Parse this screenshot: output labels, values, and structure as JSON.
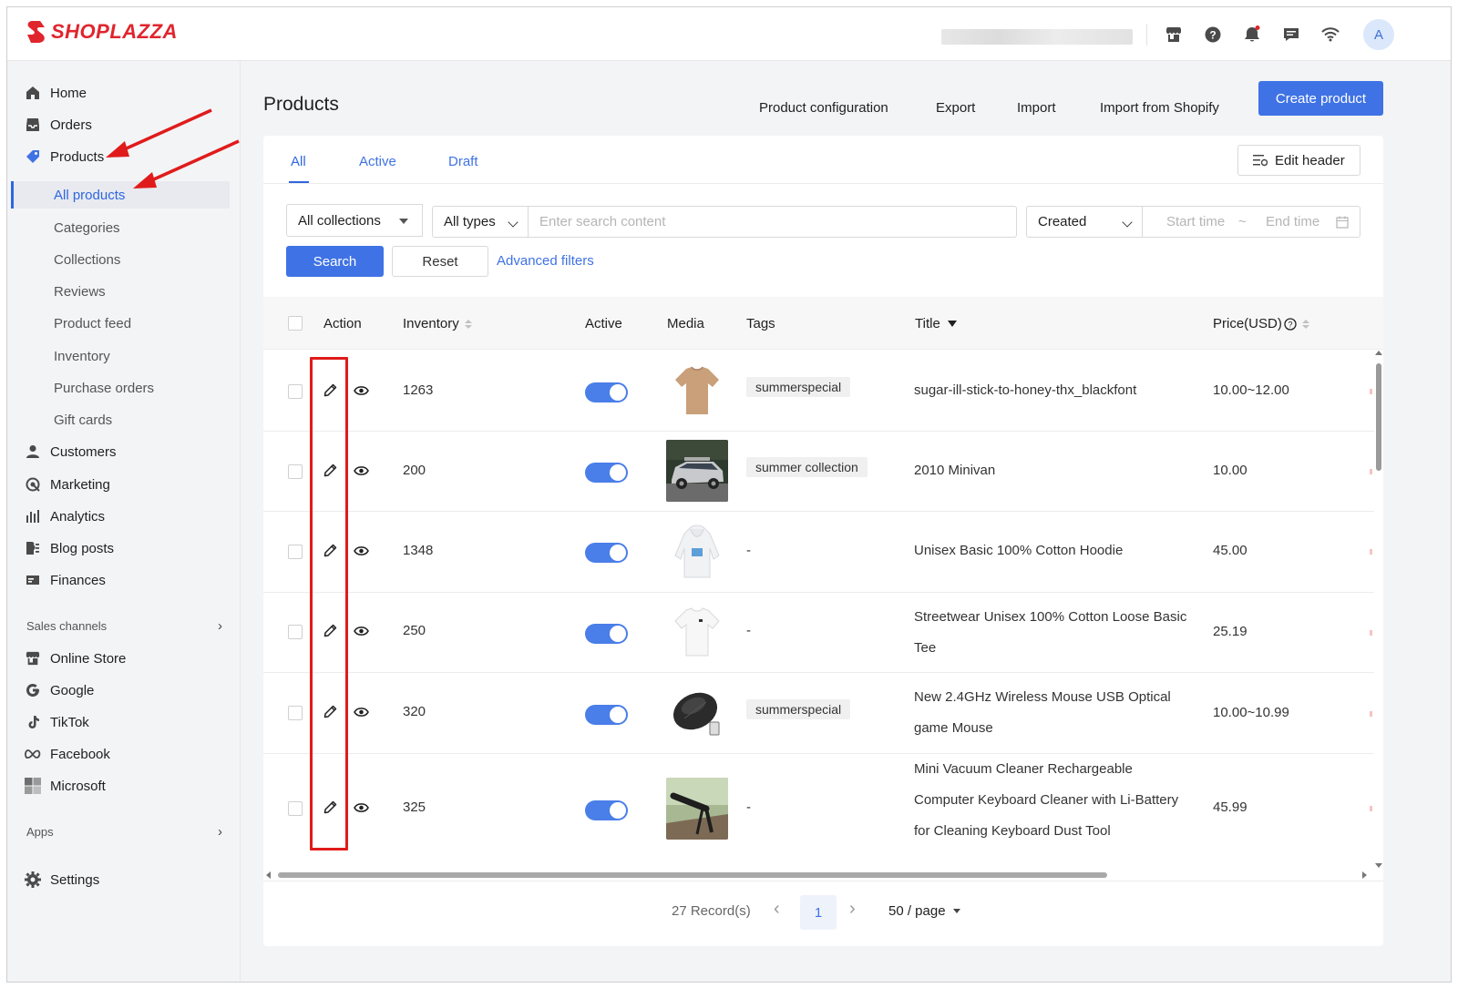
{
  "app": {
    "logo_text": "SHOPLAZZA",
    "avatar_initial": "A"
  },
  "topbar_icons": [
    "store-icon",
    "help-icon",
    "bell-icon",
    "chat-icon",
    "wifi-icon"
  ],
  "sidebar": {
    "items": [
      {
        "label": "Home",
        "icon": "home-icon"
      },
      {
        "label": "Orders",
        "icon": "inbox-icon"
      },
      {
        "label": "Products",
        "icon": "tag-icon"
      }
    ],
    "product_sub": [
      {
        "label": "All products",
        "active": true
      },
      {
        "label": "Categories"
      },
      {
        "label": "Collections"
      },
      {
        "label": "Reviews"
      },
      {
        "label": "Product feed"
      },
      {
        "label": "Inventory"
      },
      {
        "label": "Purchase orders"
      },
      {
        "label": "Gift cards"
      }
    ],
    "items2": [
      {
        "label": "Customers",
        "icon": "person-icon"
      },
      {
        "label": "Marketing",
        "icon": "marketing-icon"
      },
      {
        "label": "Analytics",
        "icon": "bar-chart-icon"
      },
      {
        "label": "Blog posts",
        "icon": "blog-icon"
      },
      {
        "label": "Finances",
        "icon": "finance-icon"
      }
    ],
    "sales_channels_label": "Sales channels",
    "channels": [
      {
        "label": "Online Store",
        "icon": "store-icon"
      },
      {
        "label": "Google",
        "icon": "google-icon"
      },
      {
        "label": "TikTok",
        "icon": "tiktok-icon"
      },
      {
        "label": "Facebook",
        "icon": "meta-icon"
      },
      {
        "label": "Microsoft",
        "icon": "microsoft-icon"
      }
    ],
    "apps_label": "Apps",
    "settings_label": "Settings"
  },
  "header": {
    "title": "Products",
    "actions": [
      "Product configuration",
      "Export",
      "Import",
      "Import from Shopify"
    ],
    "create_label": "Create product"
  },
  "tabs": [
    "All",
    "Active",
    "Draft"
  ],
  "edit_header_label": "Edit header",
  "filters": {
    "collections": "All collections",
    "types": "All types",
    "search_placeholder": "Enter search content",
    "date_field": "Created",
    "start_placeholder": "Start time",
    "range_sep": "~",
    "end_placeholder": "End time",
    "search_label": "Search",
    "reset_label": "Reset",
    "advanced_label": "Advanced filters"
  },
  "table": {
    "columns": {
      "action": "Action",
      "inventory": "Inventory",
      "active": "Active",
      "media": "Media",
      "tags": "Tags",
      "title": "Title",
      "price": "Price(USD)"
    },
    "rows": [
      {
        "inventory": "1263",
        "active": true,
        "media": "tshirt-tan",
        "tag": "summerspecial",
        "title": "sugar-ill-stick-to-honey-thx_blackfont",
        "price": "10.00~12.00"
      },
      {
        "inventory": "200",
        "active": true,
        "media": "minivan",
        "tag": "summer collection",
        "title": "2010 Minivan",
        "price": "10.00"
      },
      {
        "inventory": "1348",
        "active": true,
        "media": "hoodie",
        "tag": "-",
        "title": "Unisex Basic 100% Cotton Hoodie",
        "price": "45.00"
      },
      {
        "inventory": "250",
        "active": true,
        "media": "tee-white",
        "tag": "-",
        "title": "Streetwear Unisex 100% Cotton Loose Basic Tee",
        "price": "25.19"
      },
      {
        "inventory": "320",
        "active": true,
        "media": "mouse",
        "tag": "summerspecial",
        "title": "New 2.4GHz Wireless Mouse USB Optical game Mouse",
        "price": "10.00~10.99"
      },
      {
        "inventory": "325",
        "active": true,
        "media": "vacuum",
        "tag": "-",
        "title": "Mini Vacuum Cleaner Rechargeable Computer Keyboard Cleaner with Li-Battery for Cleaning Keyboard Dust Tool",
        "price": "45.99"
      }
    ]
  },
  "pagination": {
    "records": "27 Record(s)",
    "current_page": "1",
    "page_size": "50 / page"
  },
  "colors": {
    "accent": "#3f72e5",
    "brand": "#e0252d",
    "annotation": "#e01b1b"
  }
}
